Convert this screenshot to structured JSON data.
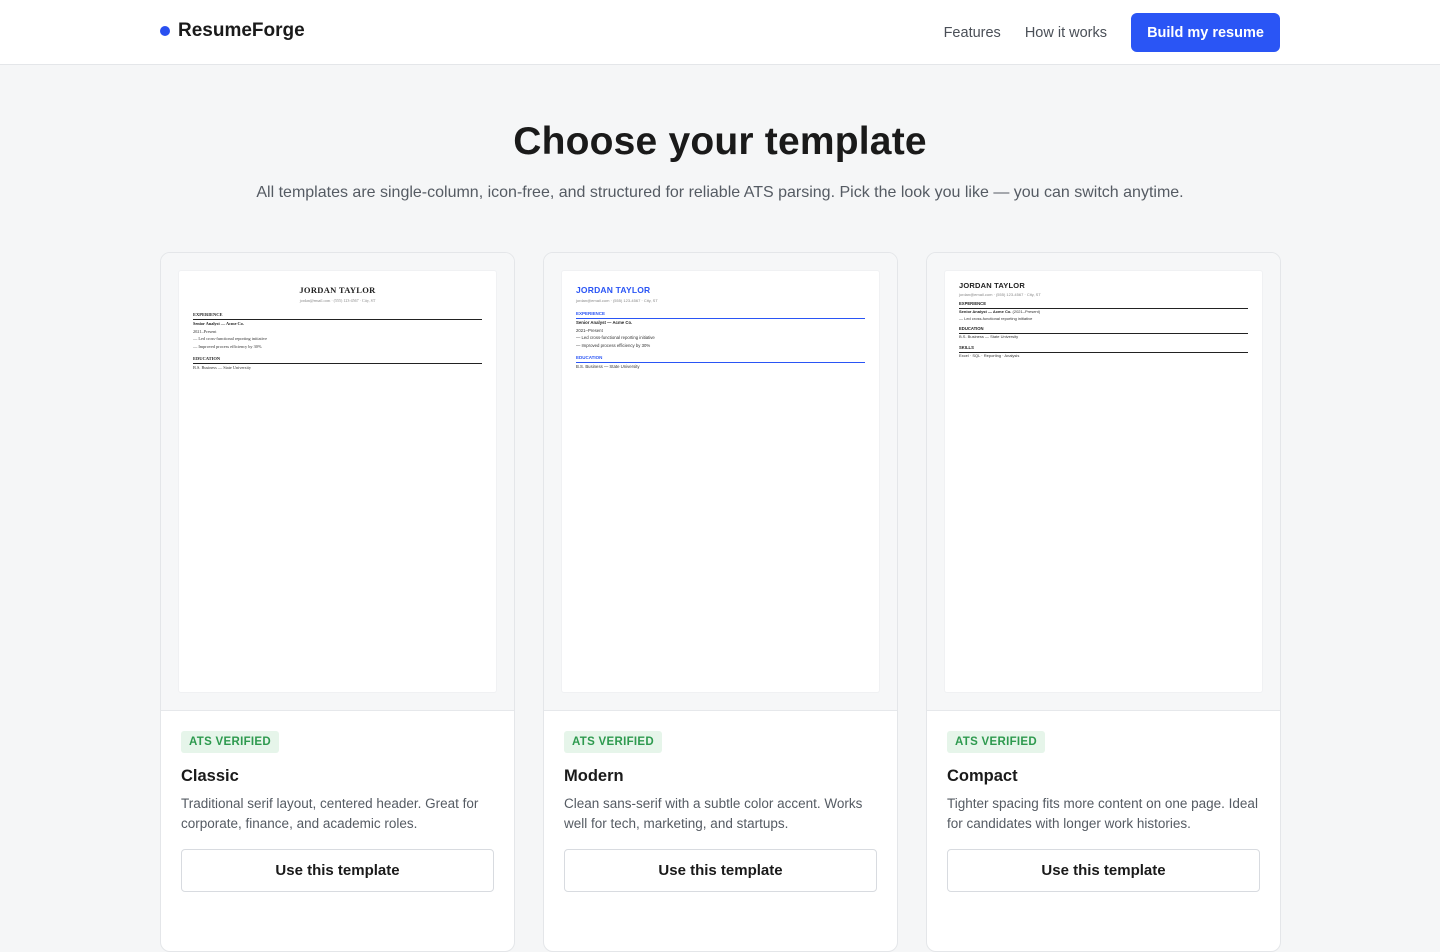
{
  "header": {
    "brand": "ResumeForge",
    "nav": [
      "Features",
      "How it works"
    ],
    "cta": "Build my resume"
  },
  "hero": {
    "title": "Choose your template",
    "subtitle": "All templates are single-column, icon-free, and structured for reliable ATS parsing. Pick the look you like — you can switch anytime."
  },
  "templates": [
    {
      "badge": "ATS VERIFIED",
      "name": "Classic",
      "description": "Traditional serif layout, centered header. Great for corporate, finance, and academic roles.",
      "button": "Use this template",
      "preview": {
        "name": "JORDAN TAYLOR",
        "contact": "jordan@email.com · (555) 123-4567 · City, ST",
        "experience_heading": "EXPERIENCE",
        "role": "Senior Analyst — Acme Co.",
        "dates": "2021–Present",
        "bullet1": "— Led cross-functional reporting initiative",
        "bullet2": "— Improved process efficiency by 30%",
        "education_heading": "EDUCATION",
        "education": "B.S. Business — State University"
      }
    },
    {
      "badge": "ATS VERIFIED",
      "name": "Modern",
      "description": "Clean sans-serif with a subtle color accent. Works well for tech, marketing, and startups.",
      "button": "Use this template",
      "preview": {
        "name": "JORDAN TAYLOR",
        "contact": "jordan@email.com · (555) 123-4567 · City, ST",
        "experience_heading": "EXPERIENCE",
        "role": "Senior Analyst — Acme Co.",
        "dates": "2021–Present",
        "bullet1": "— Led cross-functional reporting initiative",
        "bullet2": "— Improved process efficiency by 30%",
        "education_heading": "EDUCATION",
        "education": "B.S. Business — State University"
      }
    },
    {
      "badge": "ATS VERIFIED",
      "name": "Compact",
      "description": "Tighter spacing fits more content on one page. Ideal for candidates with longer work histories.",
      "button": "Use this template",
      "preview": {
        "name": "JORDAN TAYLOR",
        "contact": "jordan@email.com · (555) 123-4567 · City, ST",
        "experience_heading": "EXPERIENCE",
        "role": "Senior Analyst — Acme Co.",
        "dates": "(2021–Present)",
        "bullet1": "— Led cross-functional reporting initiative",
        "education_heading": "EDUCATION",
        "education": "B.S. Business — State University",
        "skills_heading": "SKILLS",
        "skills": "Excel · SQL · Reporting · Analysis"
      }
    }
  ],
  "colors": {
    "accent": "#2a55f5",
    "badge_bg": "#e6f5ea",
    "badge_text": "#2e9a4f"
  }
}
